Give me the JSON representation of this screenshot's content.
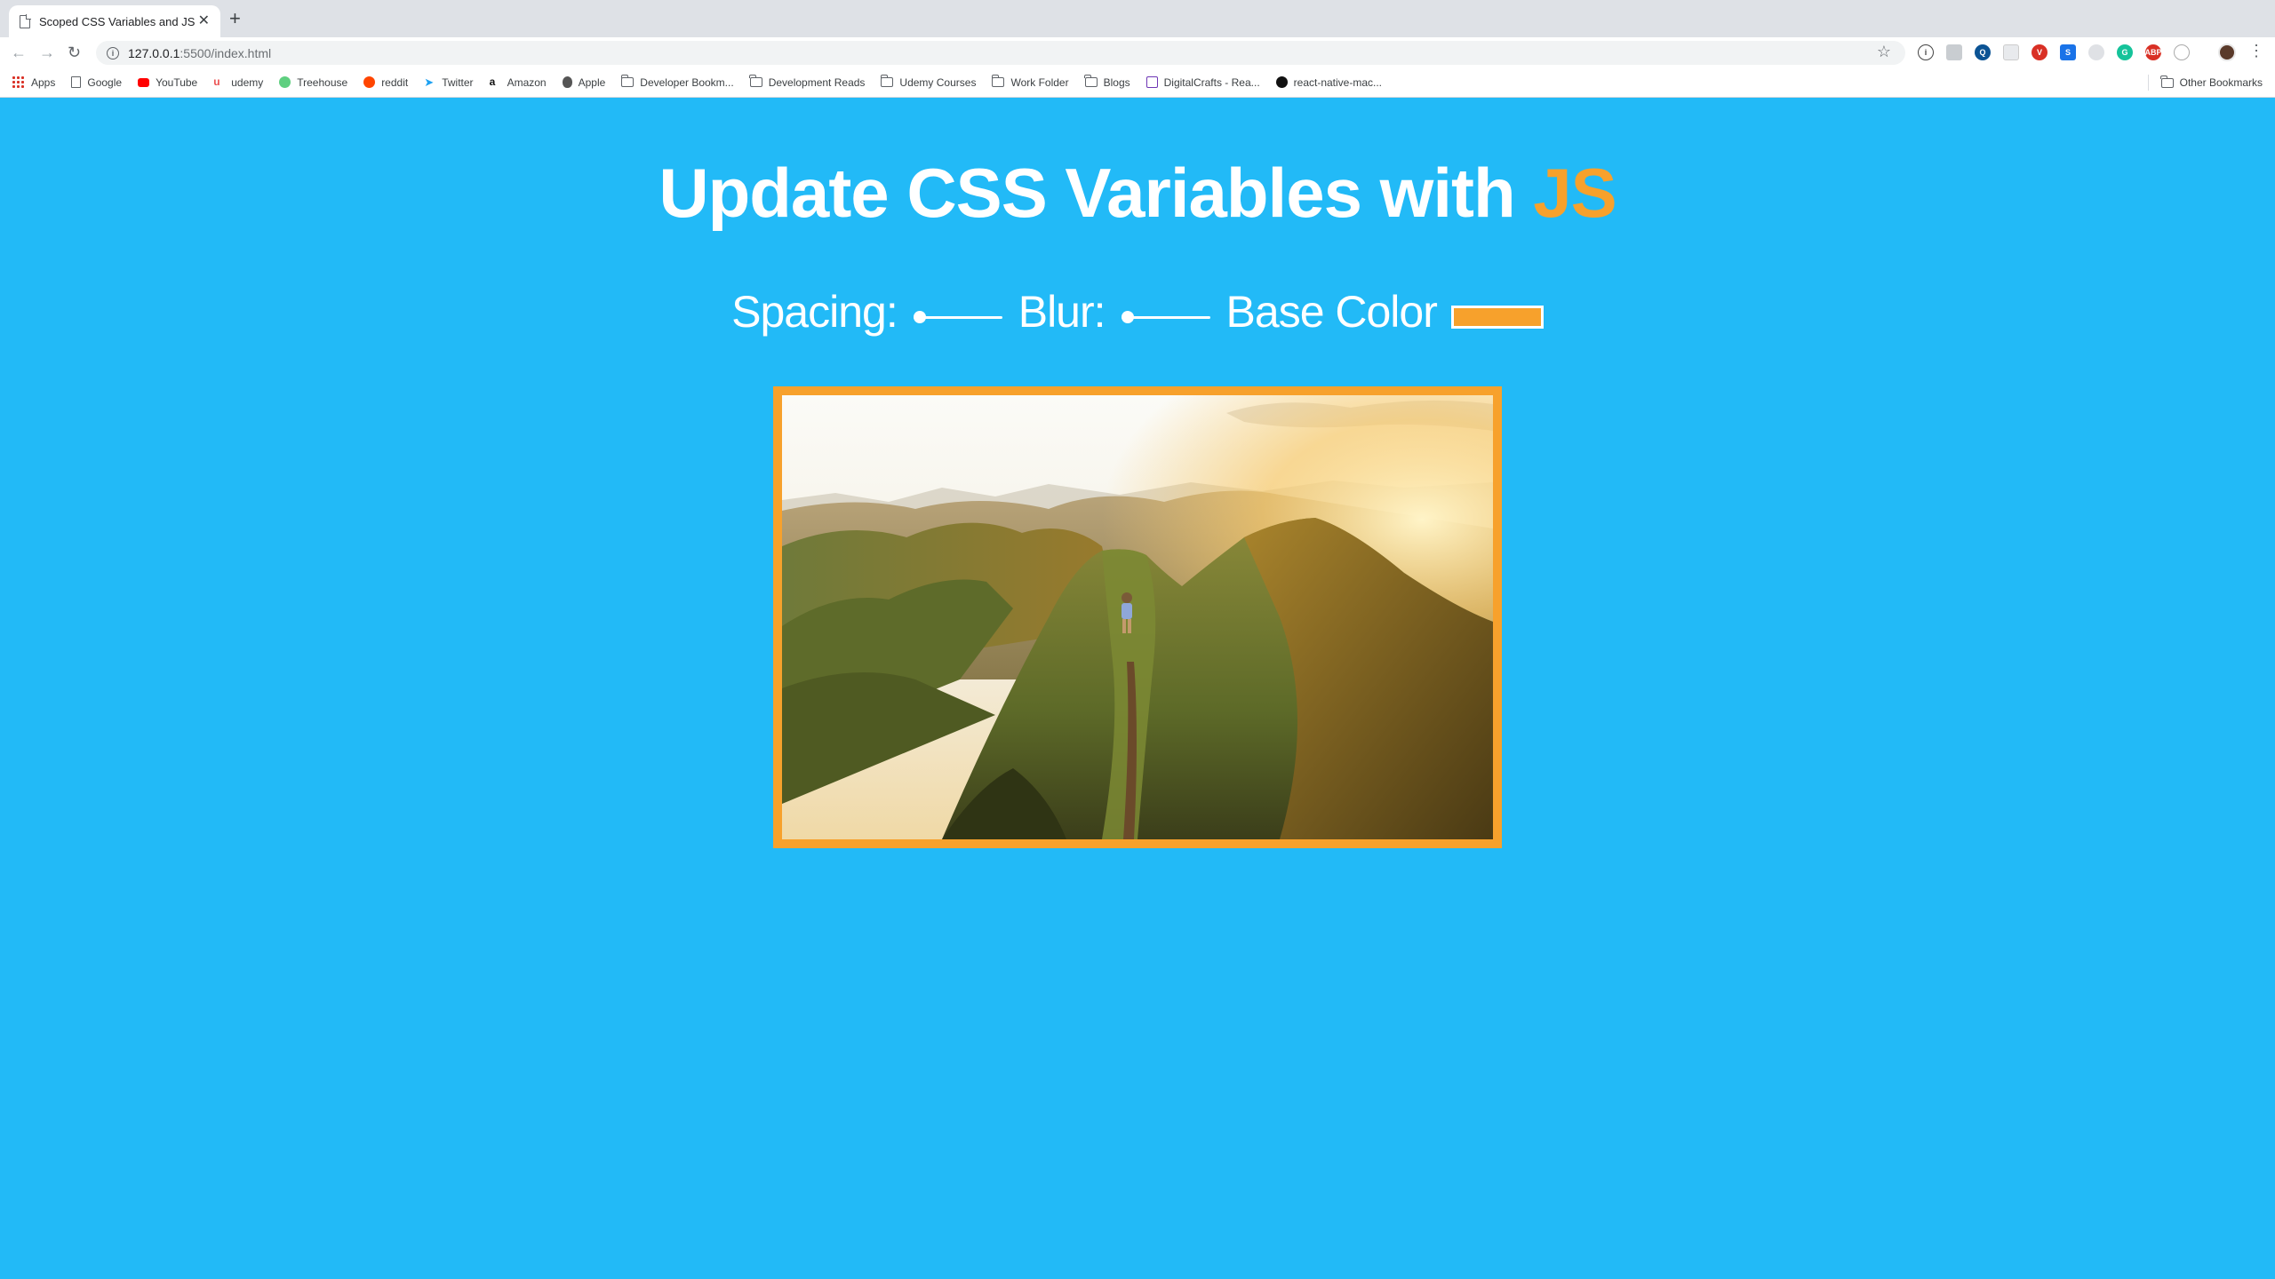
{
  "browser": {
    "tab_title": "Scoped CSS Variables and JS",
    "url_host": "127.0.0.1",
    "url_rest": ":5500/index.html"
  },
  "bookmarks": [
    {
      "label": "Apps",
      "icon": "apps-grid-icon"
    },
    {
      "label": "Google",
      "icon": "page-icon"
    },
    {
      "label": "YouTube",
      "icon": "youtube-icon"
    },
    {
      "label": "udemy",
      "icon": "udemy-icon"
    },
    {
      "label": "Treehouse",
      "icon": "treehouse-icon"
    },
    {
      "label": "reddit",
      "icon": "reddit-icon"
    },
    {
      "label": "Twitter",
      "icon": "twitter-icon"
    },
    {
      "label": "Amazon",
      "icon": "amazon-icon"
    },
    {
      "label": "Apple",
      "icon": "apple-icon"
    },
    {
      "label": "Developer Bookm...",
      "icon": "folder-icon"
    },
    {
      "label": "Development Reads",
      "icon": "folder-icon"
    },
    {
      "label": "Udemy Courses",
      "icon": "folder-icon"
    },
    {
      "label": "Work Folder",
      "icon": "folder-icon"
    },
    {
      "label": "Blogs",
      "icon": "folder-icon"
    },
    {
      "label": "DigitalCrafts - Rea...",
      "icon": "digitalcrafts-icon"
    },
    {
      "label": "react-native-mac...",
      "icon": "github-icon"
    }
  ],
  "other_bookmarks": "Other Bookmarks",
  "page": {
    "title_main": "Update CSS Variables with ",
    "title_highlight": "JS",
    "spacing_label": "Spacing:",
    "blur_label": "Blur:",
    "base_color_label": "Base Color",
    "spacing_value": 0,
    "blur_value": 0,
    "base_color": "#f7a12c"
  },
  "colors": {
    "background": "#22baf7",
    "accent": "#f7a12c"
  }
}
